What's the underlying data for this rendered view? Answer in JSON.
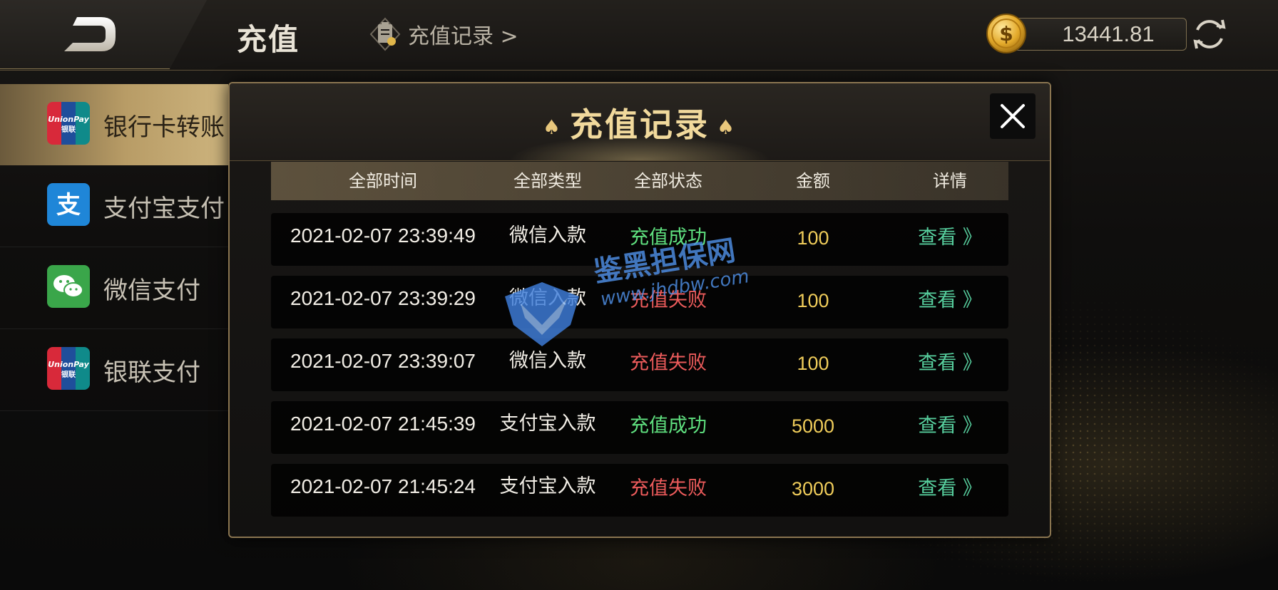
{
  "header": {
    "title": "充值",
    "record_link": "充值记录 >",
    "balance": "13441.81"
  },
  "sidebar": {
    "items": [
      {
        "label": "银行卡转账",
        "icon": "unionpay-icon",
        "active": true
      },
      {
        "label": "支付宝支付",
        "icon": "alipay-icon",
        "active": false
      },
      {
        "label": "微信支付",
        "icon": "wechat-icon",
        "active": false
      },
      {
        "label": "银联支付",
        "icon": "unionpay-icon",
        "active": false
      }
    ]
  },
  "dialog": {
    "title": "充值记录",
    "columns": [
      "全部时间",
      "全部类型",
      "全部状态",
      "金额",
      "详情"
    ],
    "rows": [
      {
        "time": "2021-02-07 23:39:49",
        "type": "微信入款",
        "status": "充值成功",
        "status_kind": "success",
        "amount": "100",
        "detail": "查看 》"
      },
      {
        "time": "2021-02-07 23:39:29",
        "type": "微信入款",
        "status": "充值失败",
        "status_kind": "fail",
        "amount": "100",
        "detail": "查看 》"
      },
      {
        "time": "2021-02-07 23:39:07",
        "type": "微信入款",
        "status": "充值失败",
        "status_kind": "fail",
        "amount": "100",
        "detail": "查看 》"
      },
      {
        "time": "2021-02-07 21:45:39",
        "type": "支付宝入款",
        "status": "充值成功",
        "status_kind": "success",
        "amount": "5000",
        "detail": "查看 》"
      },
      {
        "time": "2021-02-07 21:45:24",
        "type": "支付宝入款",
        "status": "充值失败",
        "status_kind": "fail",
        "amount": "3000",
        "detail": "查看 》"
      }
    ]
  },
  "watermark": {
    "title": "鉴黑担保网",
    "url": "www.jhdbw.com"
  },
  "colors": {
    "accent_gold": "#f1d99c",
    "success": "#5fe07f",
    "fail": "#ec5b5b",
    "amount": "#efcc5a",
    "link": "#57cf9e"
  }
}
